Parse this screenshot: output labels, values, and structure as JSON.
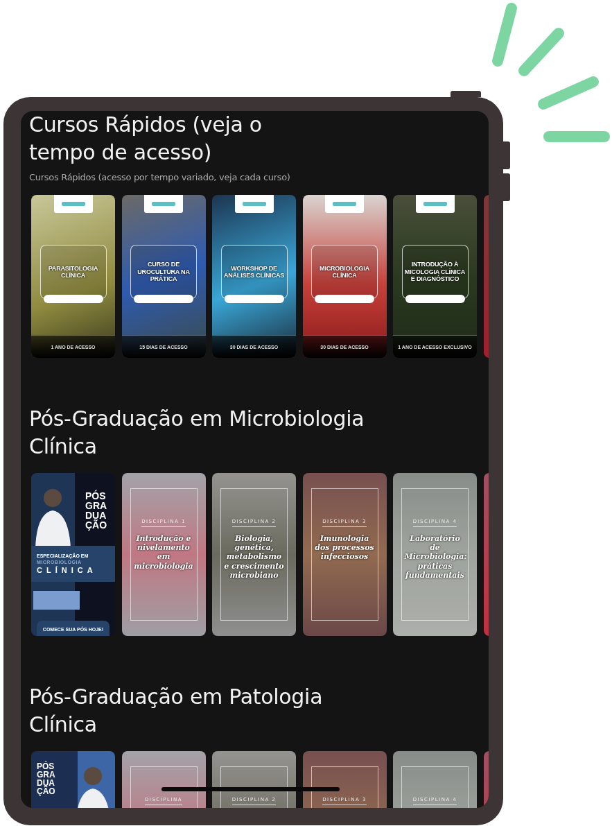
{
  "sections": [
    {
      "title": "Cursos Rápidos (veja o tempo de acesso)",
      "subtitle": "Cursos Rápidos (acesso por tempo variado, veja cada curso)",
      "cards": [
        {
          "kind": "course",
          "title": "PARASITOLOGIA CLÍNICA",
          "footer": "1 ANO DE ACESSO"
        },
        {
          "kind": "course",
          "title": "CURSO DE UROCULTURA NA PRÁTICA",
          "footer": "15 DIAS DE ACESSO"
        },
        {
          "kind": "course",
          "title": "WORKSHOP DE ANÁLISES CLÍNICAS",
          "footer": "30 DIAS DE ACESSO"
        },
        {
          "kind": "course",
          "title": "MICROBIOLOGIA CLÍNICA",
          "footer": "30 DIAS DE ACESSO"
        },
        {
          "kind": "course",
          "title": "INTRODUÇÃO À MICOLOGIA CLÍNICA E DIAGNÓSTICO",
          "footer": "1 ANO DE ACESSO EXCLUSIVO"
        },
        {
          "kind": "partial"
        }
      ]
    },
    {
      "title": "Pós-Graduação em Microbiologia Clínica",
      "cards": [
        {
          "kind": "poster",
          "headline": "PÓS GRA DUA ÇÃO",
          "lines": [
            "ESPECIALIZAÇÃO EM",
            "MICROBIOLOGIA",
            "CLÍNICA"
          ],
          "cta": "COMECE SUA PÓS HOJE!"
        },
        {
          "kind": "discipline",
          "label": "DISCIPLINA 1",
          "title": "Introdução e nivelamento em microbiologia"
        },
        {
          "kind": "discipline",
          "label": "DISCIPLINA 2",
          "title": "Biologia, genética, metabolismo e crescimento microbiano"
        },
        {
          "kind": "discipline",
          "label": "DISCIPLINA 3",
          "title": "Imunologia dos processos infecciosos"
        },
        {
          "kind": "discipline",
          "label": "DISCIPLINA 4",
          "title": "Laboratório de Microbiologia: práticas fundamentais"
        },
        {
          "kind": "partial"
        }
      ]
    },
    {
      "title": "Pós-Graduação em Patologia Clínica",
      "cards": [
        {
          "kind": "poster",
          "headline": "PÓS GRA DUA ÇÃO"
        },
        {
          "kind": "discipline",
          "label": "DISCIPLINA"
        },
        {
          "kind": "discipline",
          "label": "DISCIPLINA 2"
        },
        {
          "kind": "discipline",
          "label": "DISCIPLINA 3"
        },
        {
          "kind": "discipline",
          "label": "DISCIPLINA 4"
        },
        {
          "kind": "partial"
        }
      ]
    }
  ]
}
